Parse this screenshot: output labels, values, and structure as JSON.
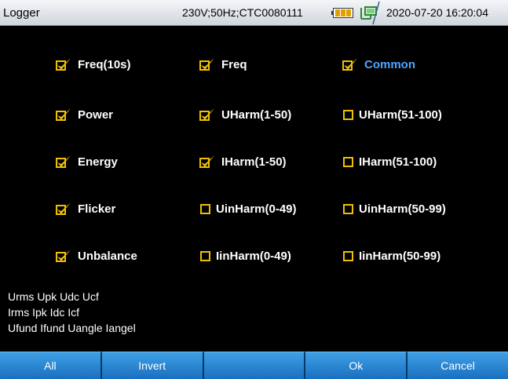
{
  "titlebar": {
    "title": "Logger",
    "info": "230V;50Hz;CTC0080111",
    "datetime": "2020-07-20 16:20:04",
    "battery_icon": "battery-icon",
    "network_icon": "network-icon"
  },
  "colors": {
    "check_accent": "#f0c000",
    "highlight_label": "#4da6ff",
    "softkey_blue": "#2a86d6"
  },
  "grid": {
    "rows": [
      [
        {
          "label": "Freq(10s)",
          "checked": true
        },
        {
          "label": "Freq",
          "checked": true
        },
        {
          "label": "Common",
          "checked": true,
          "highlight": true
        }
      ],
      [
        {
          "label": "Power",
          "checked": true
        },
        {
          "label": "UHarm(1-50)",
          "checked": true
        },
        {
          "label": "UHarm(51-100)",
          "checked": false
        }
      ],
      [
        {
          "label": "Energy",
          "checked": true
        },
        {
          "label": "IHarm(1-50)",
          "checked": true
        },
        {
          "label": "IHarm(51-100)",
          "checked": false
        }
      ],
      [
        {
          "label": "Flicker",
          "checked": true
        },
        {
          "label": "UinHarm(0-49)",
          "checked": false
        },
        {
          "label": "UinHarm(50-99)",
          "checked": false
        }
      ],
      [
        {
          "label": "Unbalance",
          "checked": true
        },
        {
          "label": "IinHarm(0-49)",
          "checked": false
        },
        {
          "label": "IinHarm(50-99)",
          "checked": false
        }
      ]
    ]
  },
  "info_lines": [
    "Urms Upk Udc Ucf",
    "Irms Ipk Idc Icf",
    "Ufund Ifund Uangle Iangel"
  ],
  "buttons": [
    "All",
    "Invert",
    "",
    "Ok",
    "Cancel"
  ]
}
